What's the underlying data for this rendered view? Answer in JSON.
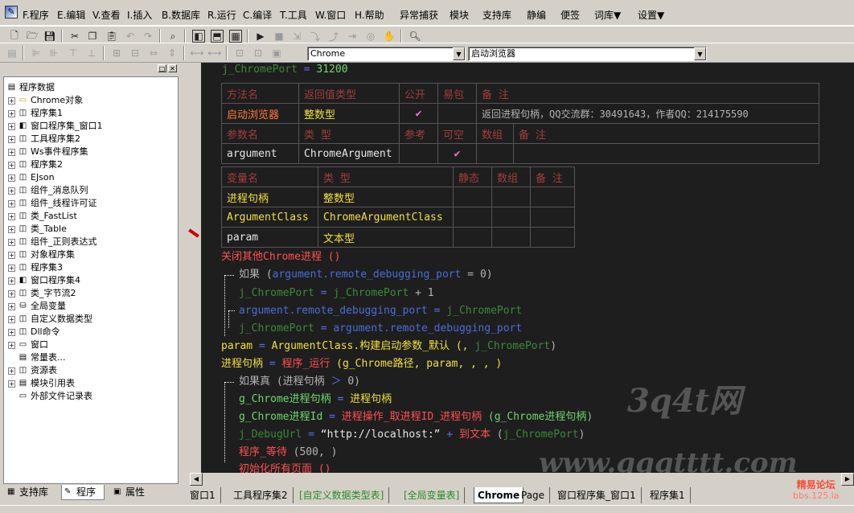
{
  "menus": [
    "F.程序",
    "E.编辑",
    "V.查看",
    "I.插入",
    "B.数据库",
    "R.运行",
    "C.编译",
    "T.工具",
    "W.窗口",
    "H.帮助",
    "异常捕获",
    "模块",
    "支持库",
    "静编",
    "便签",
    "词库▼",
    "设置▼"
  ],
  "combos": {
    "left": "Chrome",
    "right": "启动浏览器"
  },
  "tree": {
    "root": "程序数据",
    "items": [
      "Chrome对象",
      "程序集1",
      "窗口程序集_窗口1",
      "工具程序集2",
      "Ws事件程序集",
      "程序集2",
      "EJson",
      "组件_消息队列",
      "组件_线程许可证",
      "类_FastList",
      "类_Table",
      "组件_正则表达式",
      "对象程序集",
      "程序集3",
      "窗口程序集4",
      "类_字节流2",
      "全局变量",
      "自定义数据类型",
      "Dll命令",
      "窗口",
      "常量表...",
      "资源表",
      "模块引用表",
      "外部文件记录表"
    ]
  },
  "left_tabs": [
    "支持库",
    "程序",
    "属性"
  ],
  "code": {
    "top_line": {
      "var": "j_ChromePort",
      "op": "=",
      "val": "31200"
    },
    "method_table": {
      "headers": [
        "方法名",
        "返回值类型",
        "公开",
        "易包",
        "备 注"
      ],
      "row": {
        "name": "启动浏览器",
        "ret": "整数型",
        "public": "✔",
        "easy": "",
        "note": "返回进程句柄，QQ交流群：30491643，作者QQ：214175590"
      },
      "param_headers": [
        "参数名",
        "类 型",
        "参考",
        "可空",
        "数组",
        "备 注"
      ],
      "params": [
        {
          "name": "argument",
          "type": "ChromeArgument",
          "ref": "",
          "nullable": "✔",
          "array": "",
          "note": ""
        }
      ]
    },
    "local_table": {
      "headers": [
        "变量名",
        "类 型",
        "静态",
        "数组",
        "备 注"
      ],
      "rows": [
        {
          "name": "进程句柄",
          "type": "整数型"
        },
        {
          "name": "ArgumentClass",
          "type": "ChromeArgumentClass"
        },
        {
          "name": "param",
          "type": "文本型"
        }
      ]
    },
    "l1": "关闭其他Chrome进程 ()",
    "l2a": "如果 (",
    "l2b": "argument.remote_debugging_port",
    "l2c": " = 0)",
    "l3a": "j_ChromePort",
    "l3b": " = ",
    "l3c": "j_ChromePort",
    "l3d": " + 1",
    "l4a": "argument.remote_debugging_port",
    "l4b": " = ",
    "l4c": "j_ChromePort",
    "l5a": "j_ChromePort",
    "l5b": " = ",
    "l5c": "argument.remote_debugging_port",
    "l6a": "param",
    "l6b": " = ",
    "l6c": "ArgumentClass",
    "l6d": ".构建启动参数_默认 (, ",
    "l6e": "j_ChromePort",
    "l6f": ")",
    "l7a": "进程句柄",
    "l7b": " = ",
    "l7c": "程序_运行",
    "l7d": " (g_Chrome路径, param, , , )",
    "l8a": "如果真 (进程句柄 ",
    "l8b": "＞",
    "l8c": " 0)",
    "l9a": "g_Chrome进程句柄",
    "l9b": " = ",
    "l9c": "进程句柄",
    "l10a": "g_Chrome进程Id",
    "l10b": " = ",
    "l10c": "进程操作_取进程ID_进程句柄",
    "l10d": " (g_Chrome进程句柄)",
    "l11a": "j_DebugUrl",
    "l11b": " = ",
    "l11c": "“http://localhost:”",
    "l11d": " + ",
    "l11e": "到文本",
    "l11f": " (",
    "l11g": "j_ChromePort",
    "l11h": ")",
    "l12a": "程序_等待",
    "l12b": " (500, )",
    "l13": "初始化所有页面 ()"
  },
  "tabs": [
    "窗口1",
    "工具程序集2",
    "[自定义数据类型表]",
    "[全局变量表]",
    "Chrome",
    "Page",
    "窗口程序集_窗口1",
    "程序集1"
  ],
  "watermarks": [
    "3q4t网",
    "www.qqqtttt.com"
  ],
  "logo": {
    "name": "精易论坛",
    "sub": "bbs.125.la"
  }
}
